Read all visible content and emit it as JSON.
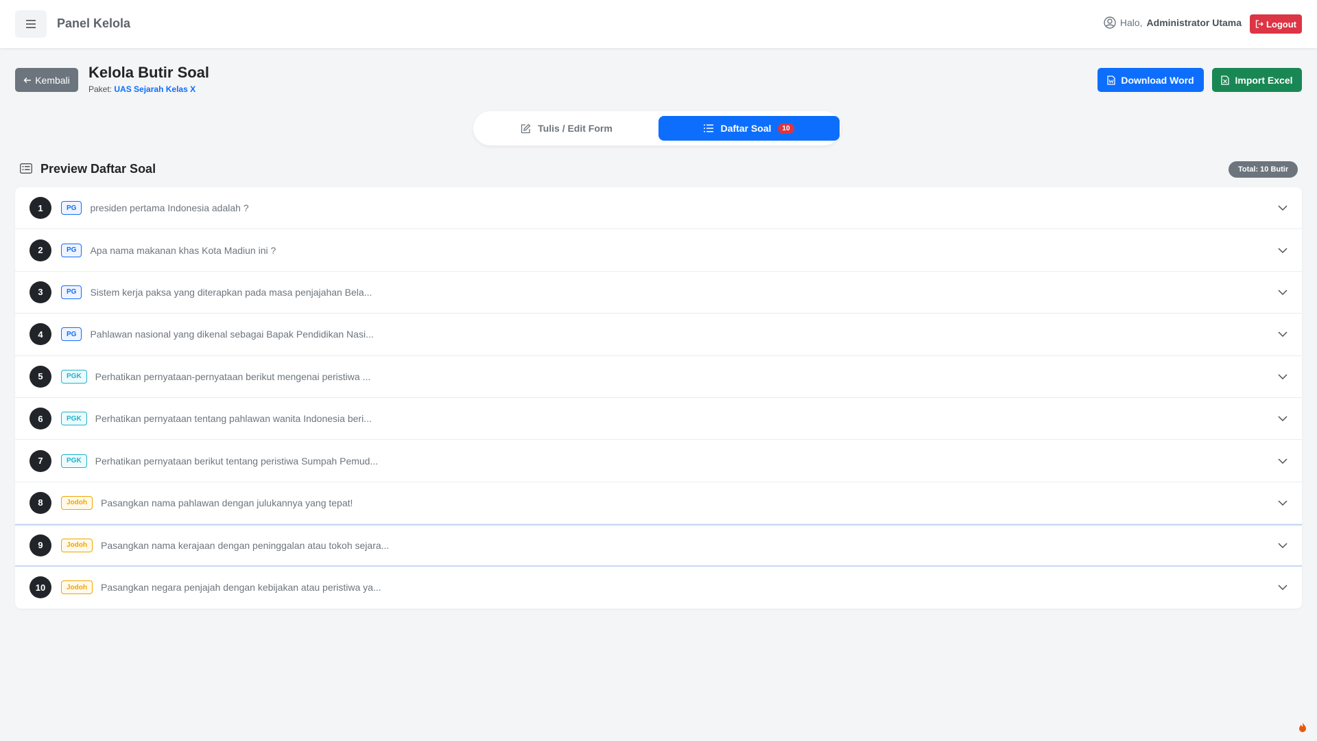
{
  "nav": {
    "brand": "Panel Kelola",
    "greeting_prefix": "Halo,",
    "user_name": "Administrator Utama",
    "logout_label": "Logout"
  },
  "header": {
    "back_label": "Kembali",
    "title": "Kelola Butir Soal",
    "package_label": "Paket:",
    "package_name": "UAS Sejarah Kelas X",
    "download_word_label": "Download Word",
    "import_excel_label": "Import Excel"
  },
  "tabs": {
    "edit_label": "Tulis / Edit Form",
    "list_label": "Daftar Soal",
    "list_count": "10"
  },
  "preview": {
    "title": "Preview Daftar Soal",
    "total_badge": "Total: 10 Butir"
  },
  "questions": [
    {
      "num": "1",
      "type": "PG",
      "text": "presiden pertama Indonesia adalah ?"
    },
    {
      "num": "2",
      "type": "PG",
      "text": "Apa nama makanan khas Kota Madiun ini ?"
    },
    {
      "num": "3",
      "type": "PG",
      "text": "Sistem kerja paksa yang diterapkan pada masa penjajahan Bela..."
    },
    {
      "num": "4",
      "type": "PG",
      "text": "Pahlawan nasional yang dikenal sebagai Bapak Pendidikan Nasi..."
    },
    {
      "num": "5",
      "type": "PGK",
      "text": "Perhatikan pernyataan-pernyataan berikut mengenai peristiwa ..."
    },
    {
      "num": "6",
      "type": "PGK",
      "text": "Perhatikan pernyataan tentang pahlawan wanita Indonesia beri..."
    },
    {
      "num": "7",
      "type": "PGK",
      "text": "Perhatikan pernyataan berikut tentang peristiwa Sumpah Pemud..."
    },
    {
      "num": "8",
      "type": "Jodoh",
      "text": "Pasangkan nama pahlawan dengan julukannya yang tepat!"
    },
    {
      "num": "9",
      "type": "Jodoh",
      "text": "Pasangkan nama kerajaan dengan peninggalan atau tokoh sejara..."
    },
    {
      "num": "10",
      "type": "Jodoh",
      "text": "Pasangkan negara penjajah dengan kebijakan atau peristiwa ya..."
    }
  ],
  "icons": {
    "menu": "hamburger-icon",
    "user": "user-circle-icon",
    "logout": "logout-icon",
    "back": "arrow-left-icon",
    "word": "file-word-icon",
    "excel": "file-excel-icon",
    "edit": "edit-icon",
    "list": "list-icon",
    "preview": "list-card-icon",
    "chevron": "chevron-down-icon",
    "fire": "fire-icon"
  },
  "colors": {
    "primary": "#0d6efd",
    "success": "#198754",
    "danger": "#dc3545",
    "secondary": "#6c757d",
    "pg": "#0d6efd",
    "pgk": "#17b5cf",
    "jodoh": "#f0a500"
  }
}
